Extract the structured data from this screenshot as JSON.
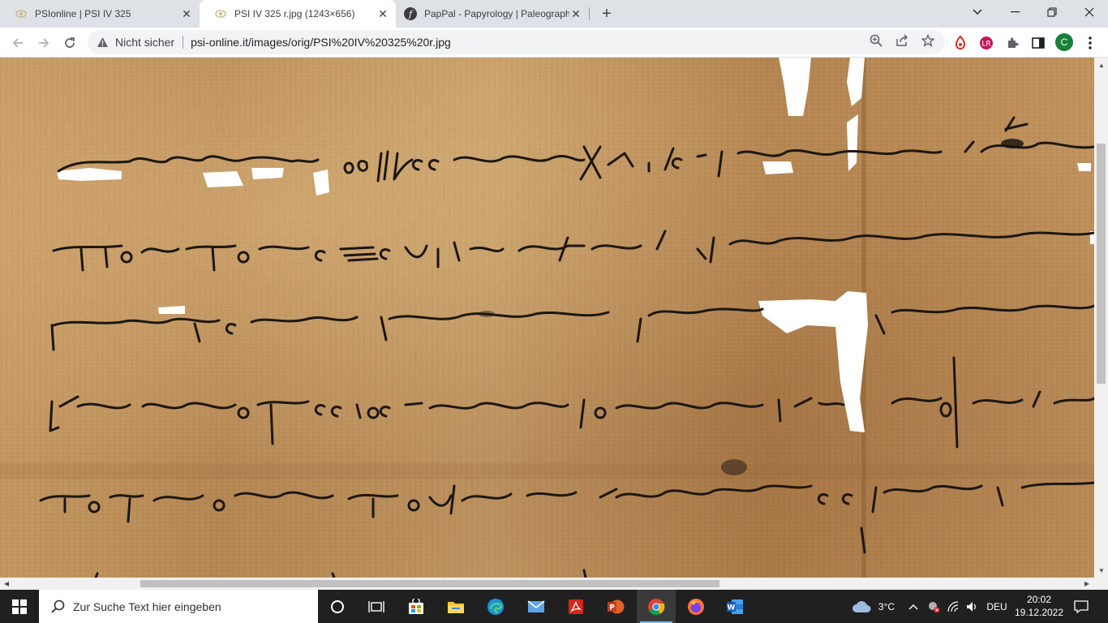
{
  "tabs": [
    {
      "title": "PSIonline | PSI IV 325",
      "favicon": "psi-favicon-icon"
    },
    {
      "title": "PSI IV 325 r.jpg (1243×656)",
      "favicon": "psi-favicon-icon"
    },
    {
      "title": "PapPal - Papyrology | Paleograph",
      "favicon": "pappal-favicon-icon"
    }
  ],
  "address_bar": {
    "security_label": "Nicht sicher",
    "url": "psi-online.it/images/orig/PSI%20IV%20325%20r.jpg"
  },
  "profile_initial": "C",
  "taskbar": {
    "search_placeholder": "Zur Suche Text hier eingeben",
    "weather": "3°C",
    "language": "DEU",
    "time": "20:02",
    "date": "19.12.2022"
  },
  "colors": {
    "tab_strip": "#dee1e6",
    "taskbar": "#202020",
    "ink": "#1c1712",
    "papyrus": "#c79a63"
  }
}
